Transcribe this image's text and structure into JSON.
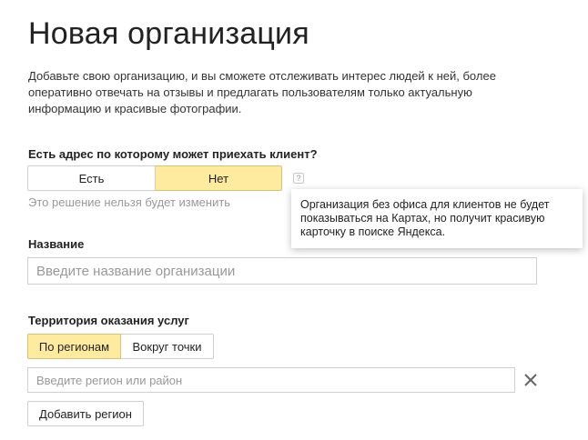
{
  "page": {
    "title": "Новая организация",
    "intro_lines": [
      "Добавьте свою организацию, и вы сможете отслеживать интерес людей к ней, более",
      "оперативно отвечать на отзывы и предлагать пользователям только актуальную",
      "информацию и красивые фотографии."
    ]
  },
  "address": {
    "question": "Есть адрес по которому может приехать клиент?",
    "options": [
      "Есть",
      "Нет"
    ],
    "selected": "Нет",
    "help_label": "?",
    "hint": "Это решение нельзя будет изменить",
    "tooltip_lines": [
      "Организация без офиса для клиентов не будет",
      "показываться на Картах, но получит красивую",
      "карточку в поиске Яндекса."
    ]
  },
  "name": {
    "label": "Название",
    "placeholder": "Введите название организации"
  },
  "territory": {
    "label": "Территория оказания услуг",
    "options": [
      "По регионам",
      "Вокруг точки"
    ],
    "selected": "По регионам",
    "region_placeholder": "Введите регион или район",
    "add_button": "Добавить регион"
  },
  "colors": {
    "selected_bg": "#ffeba0",
    "border": "#cfcfcf",
    "hint_text": "#999999"
  }
}
